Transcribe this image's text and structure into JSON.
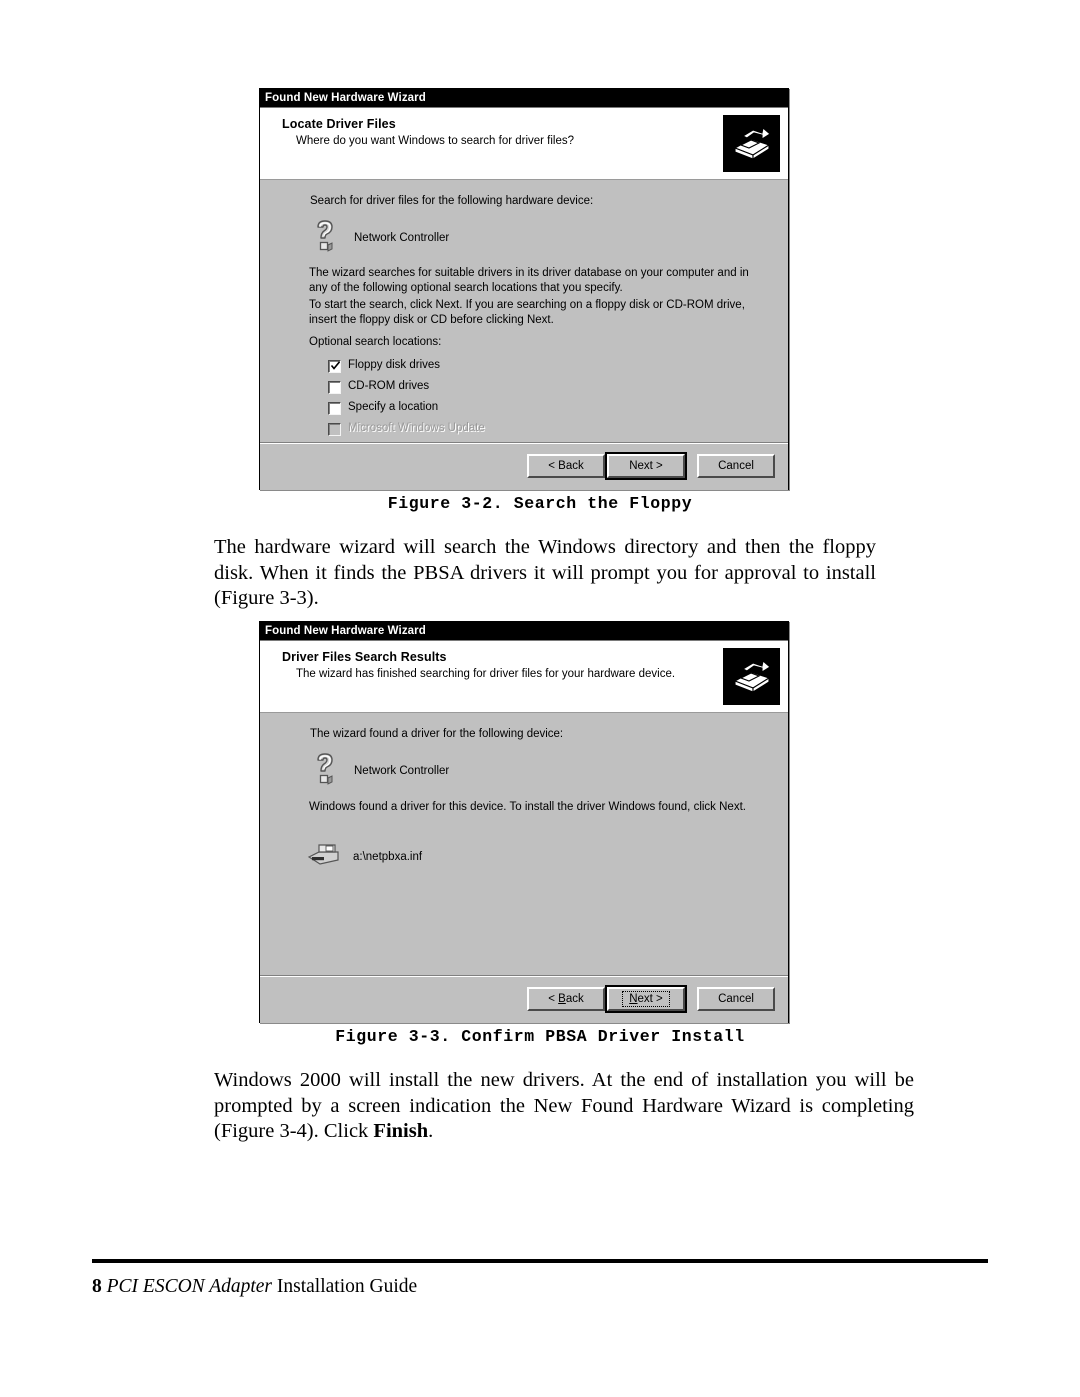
{
  "document": {
    "figure_2": {
      "caption": "Figure 3-2. Search the Floppy"
    },
    "paragraph_1": "The hardware wizard will search the Windows directory and then the floppy disk. When it finds the PBSA drivers it will prompt you for approval to install (Figure 3-3).",
    "figure_3": {
      "caption": "Figure 3-3. Confirm PBSA Driver Install"
    },
    "paragraph_2_part1": "Windows 2000 will install the new drivers.  At the end of installation you will be prompted by a screen indication the New Found Hardware Wizard is completing (Figure 3-4).  Click ",
    "paragraph_2_bold": "Finish",
    "paragraph_2_part2": ".",
    "footer": {
      "page_number": "8",
      "product": "PCI ESCON Adapter",
      "title": "Installation Guide"
    }
  },
  "dialog1": {
    "titlebar": "Found New Hardware Wizard",
    "header_title": "Locate Driver Files",
    "header_subtitle": "Where do you want Windows to search for driver files?",
    "banner_icon": "hardware-install-icon",
    "intro": "Search for driver files for the following hardware device:",
    "device_icon": "unknown-device-question-icon",
    "device_name": "Network Controller",
    "paragraph_1": "The wizard searches for suitable drivers in its driver database on your computer and in any of the following optional search locations that you specify.",
    "paragraph_2": "To start the search, click Next. If you are searching on a floppy disk or CD-ROM drive, insert the floppy disk or CD before clicking Next.",
    "group_label": "Optional search locations:",
    "checkboxes": [
      {
        "label": "Floppy disk drives",
        "checked": true,
        "disabled": false
      },
      {
        "label": "CD-ROM drives",
        "checked": false,
        "disabled": false
      },
      {
        "label": "Specify a location",
        "checked": false,
        "disabled": false
      },
      {
        "label": "Microsoft Windows Update",
        "checked": false,
        "disabled": true
      }
    ],
    "buttons": {
      "back": "< Back",
      "next": "Next >",
      "cancel": "Cancel"
    }
  },
  "dialog2": {
    "titlebar": "Found New Hardware Wizard",
    "header_title": "Driver Files Search Results",
    "header_subtitle": "The wizard has finished searching for driver files for your hardware device.",
    "banner_icon": "hardware-install-icon",
    "intro": "The wizard found a driver for the following device:",
    "device_icon": "unknown-device-question-icon",
    "device_name": "Network Controller",
    "paragraph_1": "Windows found a driver for this device. To install the driver Windows found, click Next.",
    "driver_icon": "floppy-drive-icon",
    "driver_path": "a:\\netpbxa.inf",
    "buttons": {
      "back_prefix": "< ",
      "back_accel": "B",
      "back_suffix": "ack",
      "next_accel": "N",
      "next_suffix": "ext >",
      "cancel": "Cancel"
    }
  },
  "colors": {
    "dialog_face": "#c0c0c0",
    "titlebar": "#000000",
    "header_bg": "#ffffff"
  }
}
